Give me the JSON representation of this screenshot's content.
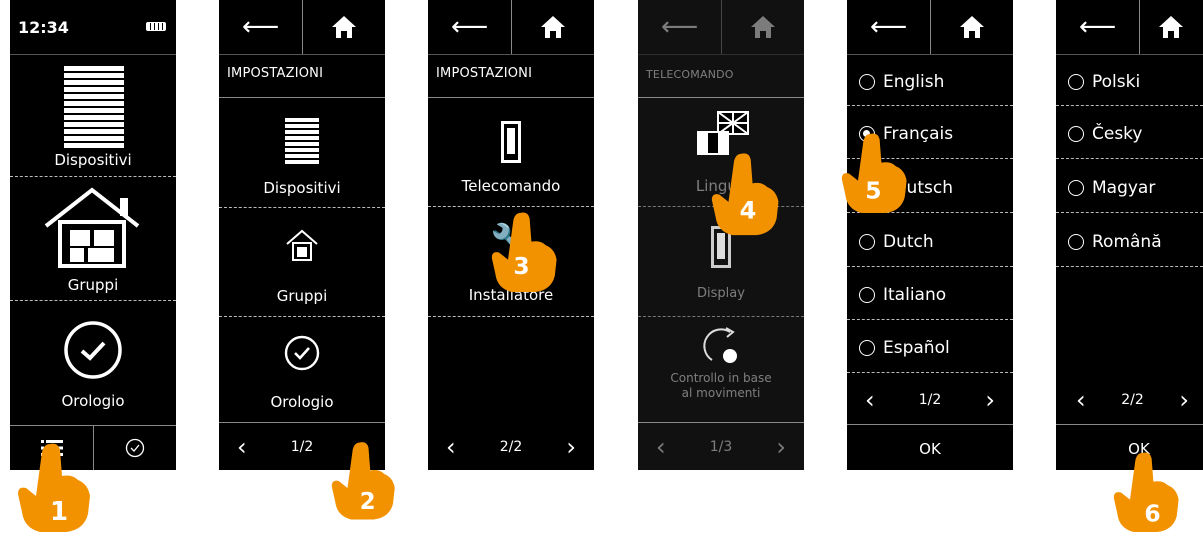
{
  "screens": {
    "s1": {
      "time": "12:34",
      "items": [
        "Dispositivi",
        "Gruppi",
        "Orologio"
      ]
    },
    "s2": {
      "title": "IMPOSTAZIONI",
      "items": [
        "Dispositivi",
        "Gruppi",
        "Orologio"
      ],
      "page": "1/2"
    },
    "s3": {
      "title": "IMPOSTAZIONI",
      "items": [
        "Telecomando",
        "Installatore"
      ],
      "page": "2/2"
    },
    "s4": {
      "title": "TELECOMANDO",
      "items": [
        "Lingue",
        "Display",
        "Controllo in base\nal movimenti"
      ],
      "page": "1/3"
    },
    "s5": {
      "languages": [
        "English",
        "Français",
        "Deutsch",
        "Dutch",
        "Italiano",
        "Español"
      ],
      "selected": "Français",
      "page": "1/2",
      "ok": "OK"
    },
    "s6": {
      "languages": [
        "Polski",
        "Česky",
        "Magyar",
        "Română"
      ],
      "page": "2/2",
      "ok": "OK"
    }
  },
  "steps": [
    "1",
    "2",
    "3",
    "4",
    "5",
    "6"
  ],
  "colors": {
    "hand": "#f39200",
    "screen": "#000000"
  }
}
